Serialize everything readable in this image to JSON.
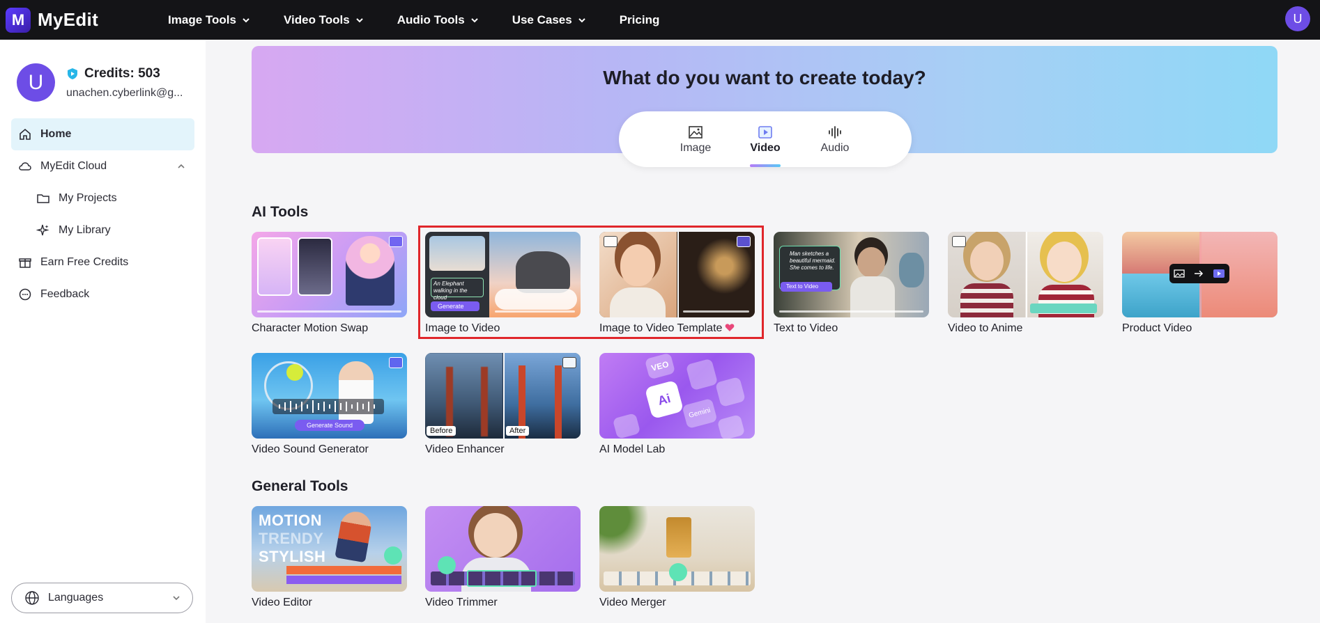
{
  "brand": {
    "name": "MyEdit",
    "logo_letter": "M"
  },
  "topnav": {
    "items": [
      {
        "label": "Image Tools",
        "has_dropdown": true
      },
      {
        "label": "Video Tools",
        "has_dropdown": true
      },
      {
        "label": "Audio Tools",
        "has_dropdown": true
      },
      {
        "label": "Use Cases",
        "has_dropdown": true
      },
      {
        "label": "Pricing",
        "has_dropdown": false
      }
    ],
    "avatar_letter": "U"
  },
  "sidebar": {
    "avatar_letter": "U",
    "credits": "Credits: 503",
    "email": "unachen.cyberlink@g...",
    "items": [
      {
        "label": "Home",
        "icon": "home-icon",
        "active": true
      },
      {
        "label": "MyEdit Cloud",
        "icon": "cloud-icon",
        "expanded": true
      },
      {
        "label": "My Projects",
        "icon": "folder-icon",
        "sub": true
      },
      {
        "label": "My Library",
        "icon": "sparkle-icon",
        "sub": true
      },
      {
        "label": "Earn Free Credits",
        "icon": "gift-icon"
      },
      {
        "label": "Feedback",
        "icon": "chat-icon"
      }
    ],
    "languages": "Languages"
  },
  "hero": {
    "title": "What do you want to create today?",
    "tabs": [
      {
        "label": "Image",
        "icon": "image-icon",
        "active": false
      },
      {
        "label": "Video",
        "icon": "video-icon",
        "active": true
      },
      {
        "label": "Audio",
        "icon": "audio-wave-icon",
        "active": false
      }
    ]
  },
  "ai_tools": {
    "title": "AI Tools",
    "cards": [
      {
        "label": "Character Motion Swap"
      },
      {
        "label": "Image to Video"
      },
      {
        "label": "Image to Video Template"
      },
      {
        "label": "Text to Video"
      },
      {
        "label": "Video to Anime"
      },
      {
        "label": "Product Video"
      },
      {
        "label": "Video Sound Generator"
      },
      {
        "label": "Video Enhancer",
        "before": "Before",
        "after": "After"
      },
      {
        "label": "AI Model Lab"
      }
    ]
  },
  "general_tools": {
    "title": "General Tools",
    "cards": [
      {
        "label": "Video Editor",
        "overlay_lines": [
          "MOTION",
          "TRENDY",
          "STYLISH"
        ]
      },
      {
        "label": "Video Trimmer"
      },
      {
        "label": "Video Merger"
      }
    ]
  },
  "thumb_text": {
    "i2v_prompt": "An Elephant walking in the cloud",
    "generate": "Generate",
    "t2v_prompt": "Man sketches a beautiful mermaid. She comes to life.",
    "t2v_button": "Text to Video",
    "sound_button": "Generate Sound",
    "model_lab_tiles": [
      "VEO",
      "Gemini"
    ]
  },
  "colors": {
    "accent": "#6d4de6",
    "highlight": "#e0262b",
    "active_nav_bg": "#e3f4fb"
  }
}
